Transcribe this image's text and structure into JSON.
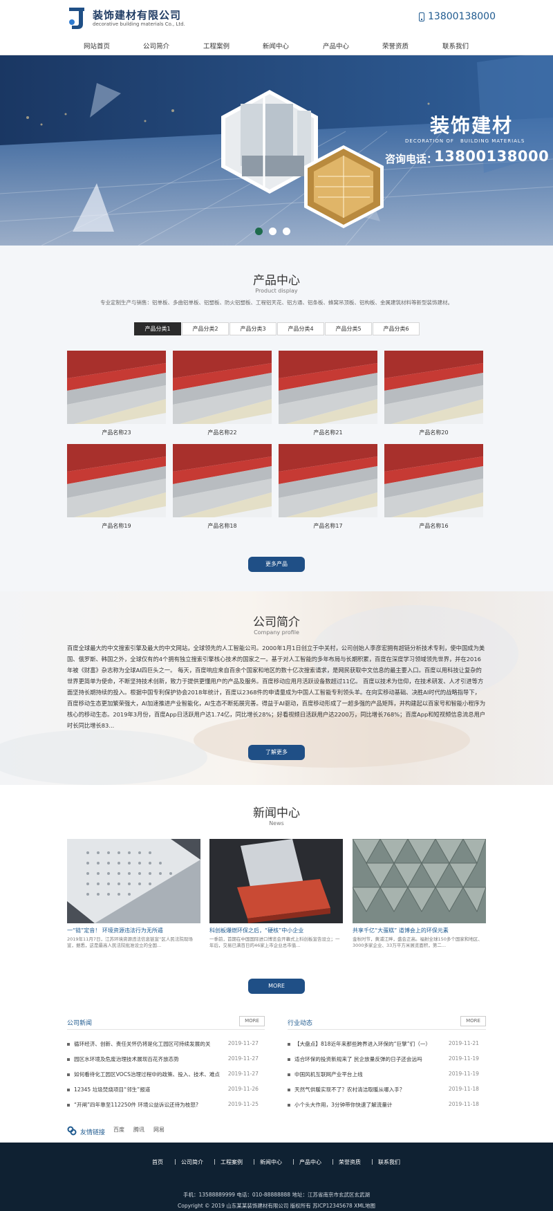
{
  "header": {
    "logo_text": "装饰建材有限公司",
    "logo_sub": "decorative building materials Co., Ltd.",
    "phone": "13800138000"
  },
  "nav": [
    "网站首页",
    "公司简介",
    "工程案例",
    "新闻中心",
    "产品中心",
    "荣誉资质",
    "联系我们"
  ],
  "banner": {
    "title": "装饰建材",
    "en_left": "DECORATION OF",
    "en_right": "BUILDING MATERIALS",
    "tel_label": "咨询电话：",
    "tel": "13800138000",
    "slides": 3,
    "active_slide": 1
  },
  "products": {
    "title": "产品中心",
    "subtitle": "Product display",
    "desc": "专业定制生产与销售：铝单板、多曲铝单板、铝塑板、防火铝塑板、工程铝天花、铝方通、铝条板、蜂窝吊顶板、铝构板、金属建筑材料等新型装饰建材。",
    "tabs": [
      "产品分类1",
      "产品分类2",
      "产品分类3",
      "产品分类4",
      "产品分类5",
      "产品分类6"
    ],
    "items": [
      "产品名称23",
      "产品名称22",
      "产品名称21",
      "产品名称20",
      "产品名称19",
      "产品名称18",
      "产品名称17",
      "产品名称16"
    ],
    "more_label": "更多产品"
  },
  "about": {
    "title": "公司简介",
    "subtitle": "Company profile",
    "text": "百度全球最大的中文搜索引擎及最大的中文网站，全球领先的人工智能公司。2000年1月1日创立于中关村，公司创始人李彦宏拥有超链分析技术专利，使中国成为美国、俄罗斯、韩国之外，全球仅有的4个拥有独立搜索引擎核心技术的国家之一。基于对人工智能的多年布局与长期积累，百度在深度学习领域领先世界，并在2016年被《财富》杂志称为全球AI四巨头之一。 每天，百度响应来自百余个国家和地区的数十亿次搜索请求，是网民获取中文信息的最主要入口。百度以用科技让复杂的世界更简单为使命，不断坚持技术创新，致力于提供更懂用户的产品及服务。百度移动应用月活跃设备数超过11亿。 百度以技术为信仰，在技术研发、人才引进等方面坚持长期持续的投入。根据中国专利保护协会2018年统计，百度以2368件的申请量成为中国人工智能专利领头羊。在向实移动基础、决胜AI时代的战略指导下，百度移动生态更加繁荣强大，AI加速推进产业智能化，AI生态不断拓展完善。得益于AI驱动，百度移动形成了一超多强的产品矩阵，并构建起以百家号和智能小程序为核心的移动生态。2019年3月份，百度App日活跃用户达1.74亿，同比增长28%；好看视频日活跃用户达2200万，同比增长768%；百度App和短视频信息流总用户时长同比增长83...",
    "more_label": "了解更多"
  },
  "news": {
    "title": "新闻中心",
    "subtitle": "News",
    "cards": [
      {
        "title": "一“链”定音！ 环境资源违法行为无所遁",
        "desc": "2019年11月7日，江苏环境资源违法信息链宣“区人民法院现场宣，据悉，这是最高人民法院批准设立的全国..."
      },
      {
        "title": "科创板爆燃环保之后，“硬核”中小企业",
        "desc": "一季前，首期在中国国际进口博览会开幕式上科创板宣告设立；一年后，交易已满百日的46家上市企业总市值..."
      },
      {
        "title": "共享千亿“大蛋糕” 道博会上的环保元素",
        "desc": "金秋时节，黄浦江畔，盛会正高。福射全球150多个国家和地区、3000多家企业、33万平方米展览面积，第二..."
      }
    ],
    "more_label": "MORE"
  },
  "company_news": {
    "title": "公司新闻",
    "more": "MORE",
    "items": [
      {
        "text": "循环经济、创新、责任关怀仍将是化工园区可持续发展的关",
        "date": "2019-11-27"
      },
      {
        "text": "园区水环境及危废治理技术展现百花齐放态势",
        "date": "2019-11-27"
      },
      {
        "text": "如何看待化工园区VOCS治理过程中的政策、投入、技术、难点",
        "date": "2019-11-27"
      },
      {
        "text": "12345 垃圾焚烧项目“邻生”报道",
        "date": "2019-11-26"
      },
      {
        "text": "“开闸”四年靠至112250件 环境公益诉讼还待为枝怒?",
        "date": "2019-11-25"
      }
    ]
  },
  "industry_news": {
    "title": "行业动态",
    "more": "MORE",
    "items": [
      {
        "text": "【大盘点】818近年来那些跨界进入环保的“巨擘”们（一）",
        "date": "2019-11-21"
      },
      {
        "text": "适合环保的投资新规来了 民企放量反弹的日子还会远吗",
        "date": "2019-11-19"
      },
      {
        "text": "中国风机互联网产业平台上线",
        "date": "2019-11-19"
      },
      {
        "text": "天然气供暖实现不了？农村清洁取暖从哪入手？",
        "date": "2019-11-18"
      },
      {
        "text": "小个头大作用，3分钟带你快速了解流量计",
        "date": "2019-11-18"
      }
    ]
  },
  "links": {
    "label": "友情链接",
    "items": [
      "百度",
      "腾讯",
      "网易"
    ]
  },
  "footer": {
    "nav": [
      "首页",
      "公司简介",
      "工程案例",
      "新闻中心",
      "产品中心",
      "荣誉资质",
      "联系我们"
    ],
    "contact": "手机：13588889999 电话：010-88888888 地址：江苏省南京市玄武区玄武湖",
    "copyright": "Copyright © 2019 山东某某装饰建材有限公司 版权所有 苏ICP12345678 XML地图"
  },
  "colors": {
    "brand": "#1f4f86",
    "link": "#1f5a8f",
    "footer_bg": "#0f2132",
    "active_dot": "#1e6b4c"
  }
}
